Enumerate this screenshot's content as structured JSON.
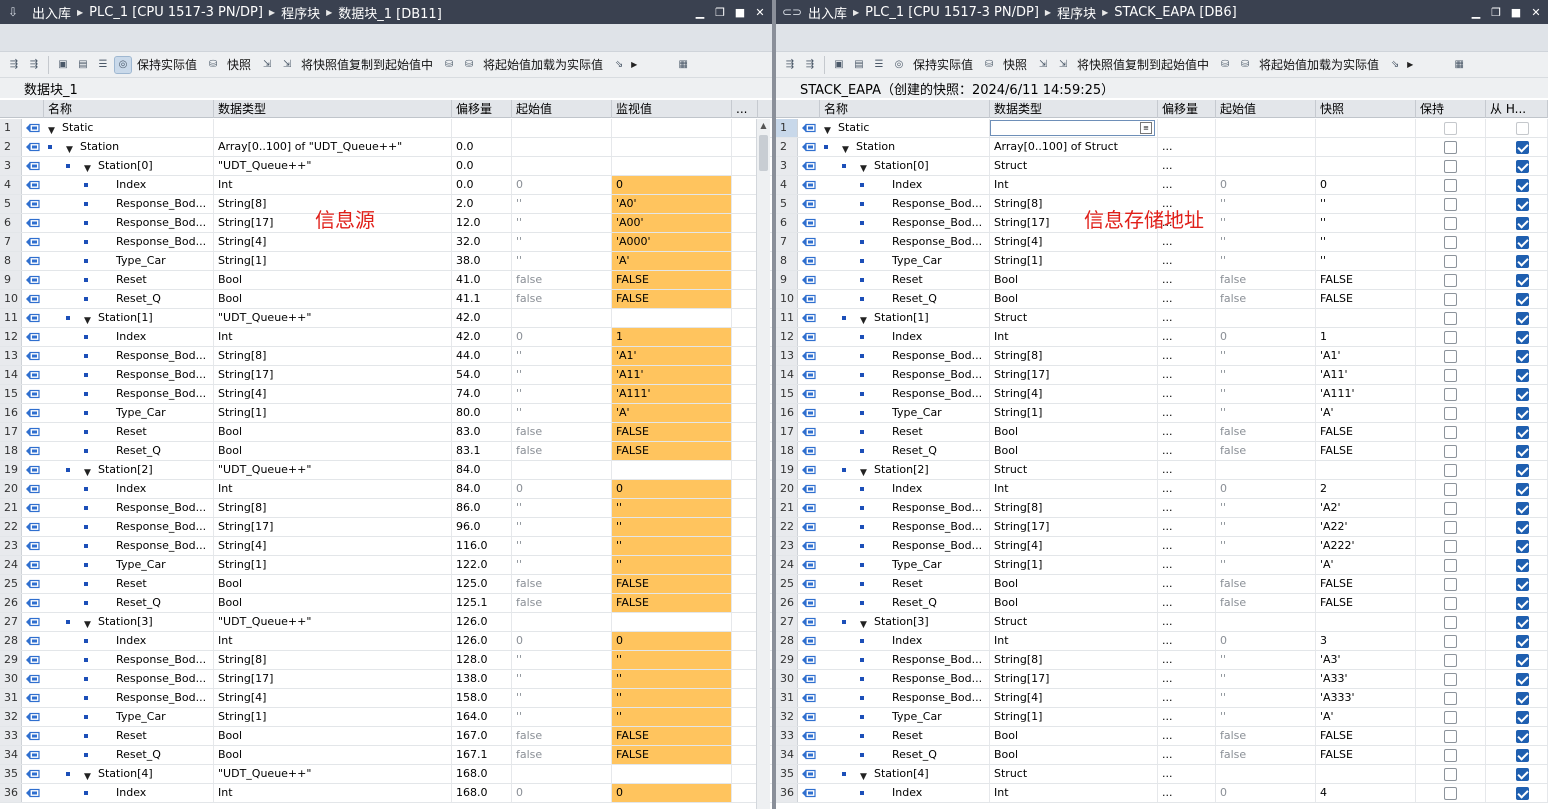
{
  "left": {
    "breadcrumb": [
      "出入库",
      "PLC_1 [CPU 1517-3 PN/DP]",
      "程序块",
      "数据块_1 [DB11]"
    ],
    "toolbar": {
      "keep_actual": "保持实际值",
      "snapshot": "快照",
      "copy_snapshot": "将快照值复制到起始值中",
      "load_start": "将起始值加载为实际值"
    },
    "block_title": "数据块_1",
    "annotation": "信息源",
    "columns": [
      "名称",
      "数据类型",
      "偏移量",
      "起始值",
      "监视值",
      "..."
    ],
    "rows": [
      {
        "n": "1",
        "lvl": 0,
        "exp": true,
        "dot": false,
        "name": "Static",
        "type": "",
        "off": "",
        "start": "",
        "mon": ""
      },
      {
        "n": "2",
        "lvl": 1,
        "exp": true,
        "dot": true,
        "name": "Station",
        "type": "Array[0..100] of \"UDT_Queue++\"",
        "off": "0.0",
        "start": "",
        "mon": ""
      },
      {
        "n": "3",
        "lvl": 2,
        "exp": true,
        "dot": true,
        "name": "Station[0]",
        "type": "\"UDT_Queue++\"",
        "off": "0.0",
        "start": "",
        "mon": ""
      },
      {
        "n": "4",
        "lvl": 3,
        "exp": false,
        "dot": true,
        "name": "Index",
        "type": "Int",
        "off": "0.0",
        "start": "0",
        "mon": "0"
      },
      {
        "n": "5",
        "lvl": 3,
        "exp": false,
        "dot": true,
        "name": "Response_Bod...",
        "type": "String[8]",
        "off": "2.0",
        "start": "''",
        "mon": "'A0'"
      },
      {
        "n": "6",
        "lvl": 3,
        "exp": false,
        "dot": true,
        "name": "Response_Bod...",
        "type": "String[17]",
        "off": "12.0",
        "start": "''",
        "mon": "'A00'"
      },
      {
        "n": "7",
        "lvl": 3,
        "exp": false,
        "dot": true,
        "name": "Response_Bod...",
        "type": "String[4]",
        "off": "32.0",
        "start": "''",
        "mon": "'A000'"
      },
      {
        "n": "8",
        "lvl": 3,
        "exp": false,
        "dot": true,
        "name": "Type_Car",
        "type": "String[1]",
        "off": "38.0",
        "start": "''",
        "mon": "'A'"
      },
      {
        "n": "9",
        "lvl": 3,
        "exp": false,
        "dot": true,
        "name": "Reset",
        "type": "Bool",
        "off": "41.0",
        "start": "false",
        "mon": "FALSE"
      },
      {
        "n": "10",
        "lvl": 3,
        "exp": false,
        "dot": true,
        "name": "Reset_Q",
        "type": "Bool",
        "off": "41.1",
        "start": "false",
        "mon": "FALSE"
      },
      {
        "n": "11",
        "lvl": 2,
        "exp": true,
        "dot": true,
        "name": "Station[1]",
        "type": "\"UDT_Queue++\"",
        "off": "42.0",
        "start": "",
        "mon": ""
      },
      {
        "n": "12",
        "lvl": 3,
        "exp": false,
        "dot": true,
        "name": "Index",
        "type": "Int",
        "off": "42.0",
        "start": "0",
        "mon": "1"
      },
      {
        "n": "13",
        "lvl": 3,
        "exp": false,
        "dot": true,
        "name": "Response_Bod...",
        "type": "String[8]",
        "off": "44.0",
        "start": "''",
        "mon": "'A1'"
      },
      {
        "n": "14",
        "lvl": 3,
        "exp": false,
        "dot": true,
        "name": "Response_Bod...",
        "type": "String[17]",
        "off": "54.0",
        "start": "''",
        "mon": "'A11'"
      },
      {
        "n": "15",
        "lvl": 3,
        "exp": false,
        "dot": true,
        "name": "Response_Bod...",
        "type": "String[4]",
        "off": "74.0",
        "start": "''",
        "mon": "'A111'"
      },
      {
        "n": "16",
        "lvl": 3,
        "exp": false,
        "dot": true,
        "name": "Type_Car",
        "type": "String[1]",
        "off": "80.0",
        "start": "''",
        "mon": "'A'"
      },
      {
        "n": "17",
        "lvl": 3,
        "exp": false,
        "dot": true,
        "name": "Reset",
        "type": "Bool",
        "off": "83.0",
        "start": "false",
        "mon": "FALSE"
      },
      {
        "n": "18",
        "lvl": 3,
        "exp": false,
        "dot": true,
        "name": "Reset_Q",
        "type": "Bool",
        "off": "83.1",
        "start": "false",
        "mon": "FALSE"
      },
      {
        "n": "19",
        "lvl": 2,
        "exp": true,
        "dot": true,
        "name": "Station[2]",
        "type": "\"UDT_Queue++\"",
        "off": "84.0",
        "start": "",
        "mon": ""
      },
      {
        "n": "20",
        "lvl": 3,
        "exp": false,
        "dot": true,
        "name": "Index",
        "type": "Int",
        "off": "84.0",
        "start": "0",
        "mon": "0"
      },
      {
        "n": "21",
        "lvl": 3,
        "exp": false,
        "dot": true,
        "name": "Response_Bod...",
        "type": "String[8]",
        "off": "86.0",
        "start": "''",
        "mon": "''"
      },
      {
        "n": "22",
        "lvl": 3,
        "exp": false,
        "dot": true,
        "name": "Response_Bod...",
        "type": "String[17]",
        "off": "96.0",
        "start": "''",
        "mon": "''"
      },
      {
        "n": "23",
        "lvl": 3,
        "exp": false,
        "dot": true,
        "name": "Response_Bod...",
        "type": "String[4]",
        "off": "116.0",
        "start": "''",
        "mon": "''"
      },
      {
        "n": "24",
        "lvl": 3,
        "exp": false,
        "dot": true,
        "name": "Type_Car",
        "type": "String[1]",
        "off": "122.0",
        "start": "''",
        "mon": "''"
      },
      {
        "n": "25",
        "lvl": 3,
        "exp": false,
        "dot": true,
        "name": "Reset",
        "type": "Bool",
        "off": "125.0",
        "start": "false",
        "mon": "FALSE"
      },
      {
        "n": "26",
        "lvl": 3,
        "exp": false,
        "dot": true,
        "name": "Reset_Q",
        "type": "Bool",
        "off": "125.1",
        "start": "false",
        "mon": "FALSE"
      },
      {
        "n": "27",
        "lvl": 2,
        "exp": true,
        "dot": true,
        "name": "Station[3]",
        "type": "\"UDT_Queue++\"",
        "off": "126.0",
        "start": "",
        "mon": ""
      },
      {
        "n": "28",
        "lvl": 3,
        "exp": false,
        "dot": true,
        "name": "Index",
        "type": "Int",
        "off": "126.0",
        "start": "0",
        "mon": "0"
      },
      {
        "n": "29",
        "lvl": 3,
        "exp": false,
        "dot": true,
        "name": "Response_Bod...",
        "type": "String[8]",
        "off": "128.0",
        "start": "''",
        "mon": "''"
      },
      {
        "n": "30",
        "lvl": 3,
        "exp": false,
        "dot": true,
        "name": "Response_Bod...",
        "type": "String[17]",
        "off": "138.0",
        "start": "''",
        "mon": "''"
      },
      {
        "n": "31",
        "lvl": 3,
        "exp": false,
        "dot": true,
        "name": "Response_Bod...",
        "type": "String[4]",
        "off": "158.0",
        "start": "''",
        "mon": "''"
      },
      {
        "n": "32",
        "lvl": 3,
        "exp": false,
        "dot": true,
        "name": "Type_Car",
        "type": "String[1]",
        "off": "164.0",
        "start": "''",
        "mon": "''"
      },
      {
        "n": "33",
        "lvl": 3,
        "exp": false,
        "dot": true,
        "name": "Reset",
        "type": "Bool",
        "off": "167.0",
        "start": "false",
        "mon": "FALSE"
      },
      {
        "n": "34",
        "lvl": 3,
        "exp": false,
        "dot": true,
        "name": "Reset_Q",
        "type": "Bool",
        "off": "167.1",
        "start": "false",
        "mon": "FALSE"
      },
      {
        "n": "35",
        "lvl": 2,
        "exp": true,
        "dot": true,
        "name": "Station[4]",
        "type": "\"UDT_Queue++\"",
        "off": "168.0",
        "start": "",
        "mon": ""
      },
      {
        "n": "36",
        "lvl": 3,
        "exp": false,
        "dot": true,
        "name": "Index",
        "type": "Int",
        "off": "168.0",
        "start": "0",
        "mon": "0"
      }
    ]
  },
  "right": {
    "breadcrumb": [
      "出入库",
      "PLC_1 [CPU 1517-3 PN/DP]",
      "程序块",
      "STACK_EAPA [DB6]"
    ],
    "toolbar": {
      "keep_actual": "保持实际值",
      "snapshot": "快照",
      "copy_snapshot": "将快照值复制到起始值中",
      "load_start": "将起始值加载为实际值"
    },
    "block_title": "STACK_EAPA（创建的快照：2024/6/11 14:59:25）",
    "annotation": "信息存储地址",
    "columns": [
      "名称",
      "数据类型",
      "偏移量",
      "起始值",
      "快照",
      "保持",
      "从 H..."
    ],
    "rows": [
      {
        "n": "1",
        "lvl": 0,
        "exp": true,
        "dot": false,
        "name": "Static",
        "type": "",
        "off": "",
        "start": "",
        "snap": "",
        "hmi": false
      },
      {
        "n": "2",
        "lvl": 1,
        "exp": true,
        "dot": true,
        "name": "Station",
        "type": "Array[0..100] of Struct",
        "off": "...",
        "start": "",
        "snap": "",
        "hmi": true
      },
      {
        "n": "3",
        "lvl": 2,
        "exp": true,
        "dot": true,
        "name": "Station[0]",
        "type": "Struct",
        "off": "...",
        "start": "",
        "snap": "",
        "hmi": true
      },
      {
        "n": "4",
        "lvl": 3,
        "exp": false,
        "dot": true,
        "name": "Index",
        "type": "Int",
        "off": "...",
        "start": "0",
        "snap": "0",
        "hmi": true
      },
      {
        "n": "5",
        "lvl": 3,
        "exp": false,
        "dot": true,
        "name": "Response_Bod...",
        "type": "String[8]",
        "off": "...",
        "start": "''",
        "snap": "''",
        "hmi": true
      },
      {
        "n": "6",
        "lvl": 3,
        "exp": false,
        "dot": true,
        "name": "Response_Bod...",
        "type": "String[17]",
        "off": "...",
        "start": "''",
        "snap": "''",
        "hmi": true
      },
      {
        "n": "7",
        "lvl": 3,
        "exp": false,
        "dot": true,
        "name": "Response_Bod...",
        "type": "String[4]",
        "off": "...",
        "start": "''",
        "snap": "''",
        "hmi": true
      },
      {
        "n": "8",
        "lvl": 3,
        "exp": false,
        "dot": true,
        "name": "Type_Car",
        "type": "String[1]",
        "off": "...",
        "start": "''",
        "snap": "''",
        "hmi": true
      },
      {
        "n": "9",
        "lvl": 3,
        "exp": false,
        "dot": true,
        "name": "Reset",
        "type": "Bool",
        "off": "...",
        "start": "false",
        "snap": "FALSE",
        "hmi": true
      },
      {
        "n": "10",
        "lvl": 3,
        "exp": false,
        "dot": true,
        "name": "Reset_Q",
        "type": "Bool",
        "off": "...",
        "start": "false",
        "snap": "FALSE",
        "hmi": true
      },
      {
        "n": "11",
        "lvl": 2,
        "exp": true,
        "dot": true,
        "name": "Station[1]",
        "type": "Struct",
        "off": "...",
        "start": "",
        "snap": "",
        "hmi": true
      },
      {
        "n": "12",
        "lvl": 3,
        "exp": false,
        "dot": true,
        "name": "Index",
        "type": "Int",
        "off": "...",
        "start": "0",
        "snap": "1",
        "hmi": true
      },
      {
        "n": "13",
        "lvl": 3,
        "exp": false,
        "dot": true,
        "name": "Response_Bod...",
        "type": "String[8]",
        "off": "...",
        "start": "''",
        "snap": "'A1'",
        "hmi": true
      },
      {
        "n": "14",
        "lvl": 3,
        "exp": false,
        "dot": true,
        "name": "Response_Bod...",
        "type": "String[17]",
        "off": "...",
        "start": "''",
        "snap": "'A11'",
        "hmi": true
      },
      {
        "n": "15",
        "lvl": 3,
        "exp": false,
        "dot": true,
        "name": "Response_Bod...",
        "type": "String[4]",
        "off": "...",
        "start": "''",
        "snap": "'A111'",
        "hmi": true
      },
      {
        "n": "16",
        "lvl": 3,
        "exp": false,
        "dot": true,
        "name": "Type_Car",
        "type": "String[1]",
        "off": "...",
        "start": "''",
        "snap": "'A'",
        "hmi": true
      },
      {
        "n": "17",
        "lvl": 3,
        "exp": false,
        "dot": true,
        "name": "Reset",
        "type": "Bool",
        "off": "...",
        "start": "false",
        "snap": "FALSE",
        "hmi": true
      },
      {
        "n": "18",
        "lvl": 3,
        "exp": false,
        "dot": true,
        "name": "Reset_Q",
        "type": "Bool",
        "off": "...",
        "start": "false",
        "snap": "FALSE",
        "hmi": true
      },
      {
        "n": "19",
        "lvl": 2,
        "exp": true,
        "dot": true,
        "name": "Station[2]",
        "type": "Struct",
        "off": "...",
        "start": "",
        "snap": "",
        "hmi": true
      },
      {
        "n": "20",
        "lvl": 3,
        "exp": false,
        "dot": true,
        "name": "Index",
        "type": "Int",
        "off": "...",
        "start": "0",
        "snap": "2",
        "hmi": true
      },
      {
        "n": "21",
        "lvl": 3,
        "exp": false,
        "dot": true,
        "name": "Response_Bod...",
        "type": "String[8]",
        "off": "...",
        "start": "''",
        "snap": "'A2'",
        "hmi": true
      },
      {
        "n": "22",
        "lvl": 3,
        "exp": false,
        "dot": true,
        "name": "Response_Bod...",
        "type": "String[17]",
        "off": "...",
        "start": "''",
        "snap": "'A22'",
        "hmi": true
      },
      {
        "n": "23",
        "lvl": 3,
        "exp": false,
        "dot": true,
        "name": "Response_Bod...",
        "type": "String[4]",
        "off": "...",
        "start": "''",
        "snap": "'A222'",
        "hmi": true
      },
      {
        "n": "24",
        "lvl": 3,
        "exp": false,
        "dot": true,
        "name": "Type_Car",
        "type": "String[1]",
        "off": "...",
        "start": "''",
        "snap": "'A'",
        "hmi": true
      },
      {
        "n": "25",
        "lvl": 3,
        "exp": false,
        "dot": true,
        "name": "Reset",
        "type": "Bool",
        "off": "...",
        "start": "false",
        "snap": "FALSE",
        "hmi": true
      },
      {
        "n": "26",
        "lvl": 3,
        "exp": false,
        "dot": true,
        "name": "Reset_Q",
        "type": "Bool",
        "off": "...",
        "start": "false",
        "snap": "FALSE",
        "hmi": true
      },
      {
        "n": "27",
        "lvl": 2,
        "exp": true,
        "dot": true,
        "name": "Station[3]",
        "type": "Struct",
        "off": "...",
        "start": "",
        "snap": "",
        "hmi": true
      },
      {
        "n": "28",
        "lvl": 3,
        "exp": false,
        "dot": true,
        "name": "Index",
        "type": "Int",
        "off": "...",
        "start": "0",
        "snap": "3",
        "hmi": true
      },
      {
        "n": "29",
        "lvl": 3,
        "exp": false,
        "dot": true,
        "name": "Response_Bod...",
        "type": "String[8]",
        "off": "...",
        "start": "''",
        "snap": "'A3'",
        "hmi": true
      },
      {
        "n": "30",
        "lvl": 3,
        "exp": false,
        "dot": true,
        "name": "Response_Bod...",
        "type": "String[17]",
        "off": "...",
        "start": "''",
        "snap": "'A33'",
        "hmi": true
      },
      {
        "n": "31",
        "lvl": 3,
        "exp": false,
        "dot": true,
        "name": "Response_Bod...",
        "type": "String[4]",
        "off": "...",
        "start": "''",
        "snap": "'A333'",
        "hmi": true
      },
      {
        "n": "32",
        "lvl": 3,
        "exp": false,
        "dot": true,
        "name": "Type_Car",
        "type": "String[1]",
        "off": "...",
        "start": "''",
        "snap": "'A'",
        "hmi": true
      },
      {
        "n": "33",
        "lvl": 3,
        "exp": false,
        "dot": true,
        "name": "Reset",
        "type": "Bool",
        "off": "...",
        "start": "false",
        "snap": "FALSE",
        "hmi": true
      },
      {
        "n": "34",
        "lvl": 3,
        "exp": false,
        "dot": true,
        "name": "Reset_Q",
        "type": "Bool",
        "off": "...",
        "start": "false",
        "snap": "FALSE",
        "hmi": true
      },
      {
        "n": "35",
        "lvl": 2,
        "exp": true,
        "dot": true,
        "name": "Station[4]",
        "type": "Struct",
        "off": "...",
        "start": "",
        "snap": "",
        "hmi": true
      },
      {
        "n": "36",
        "lvl": 3,
        "exp": false,
        "dot": true,
        "name": "Index",
        "type": "Int",
        "off": "...",
        "start": "0",
        "snap": "4",
        "hmi": true
      }
    ]
  },
  "colors": {
    "titlebar": "#3a4150",
    "monitor_highlight": "#ffc45e",
    "annotation": "#e0201a",
    "checkbox_on": "#1f5fb0"
  }
}
